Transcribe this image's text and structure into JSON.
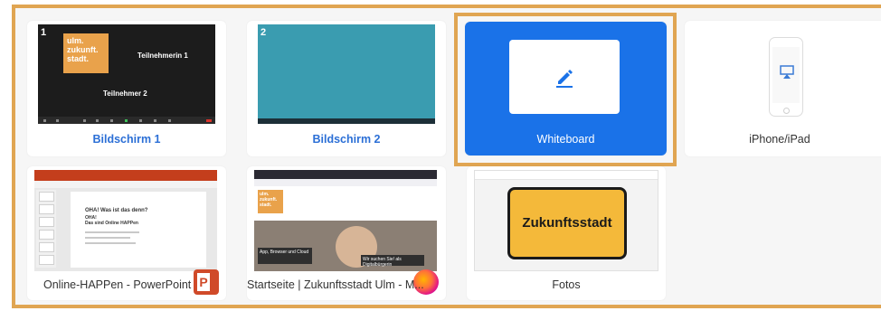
{
  "tiles": [
    {
      "label": "Bildschirm 1",
      "badge": "1",
      "logo_text": "ulm.\nzukunft.\nstadt.",
      "participant_1": "Teilnehmerin 1",
      "participant_2": "Teilnehmer 2"
    },
    {
      "label": "Bildschirm 2",
      "badge": "2"
    },
    {
      "label": "Whiteboard",
      "icon": "pencil-icon",
      "selected": true
    },
    {
      "label": "iPhone/iPad",
      "icon": "airplay-icon"
    },
    {
      "label": "Online-HAPPen - PowerPoint",
      "icon": "powerpoint-icon",
      "slide_title": "OHA! Was ist das denn?",
      "slide_sub": "OHA!\nDas sind Online HAPPen",
      "app_letter": "P"
    },
    {
      "label": "Startseite | Zukunftsstadt Ulm - M...",
      "icon": "firefox-icon",
      "caption_1": "App, Browser und Cloud",
      "caption_2": "Wir suchen Sie! als Digitalbürgerin"
    },
    {
      "label": "Fotos",
      "sign_text": "Zukunftsstadt"
    }
  ],
  "colors": {
    "selection_border": "#e0a552",
    "whiteboard_bg": "#1a72e8",
    "screen_label": "#2b6fd6",
    "sign_yellow": "#f4b93a"
  }
}
